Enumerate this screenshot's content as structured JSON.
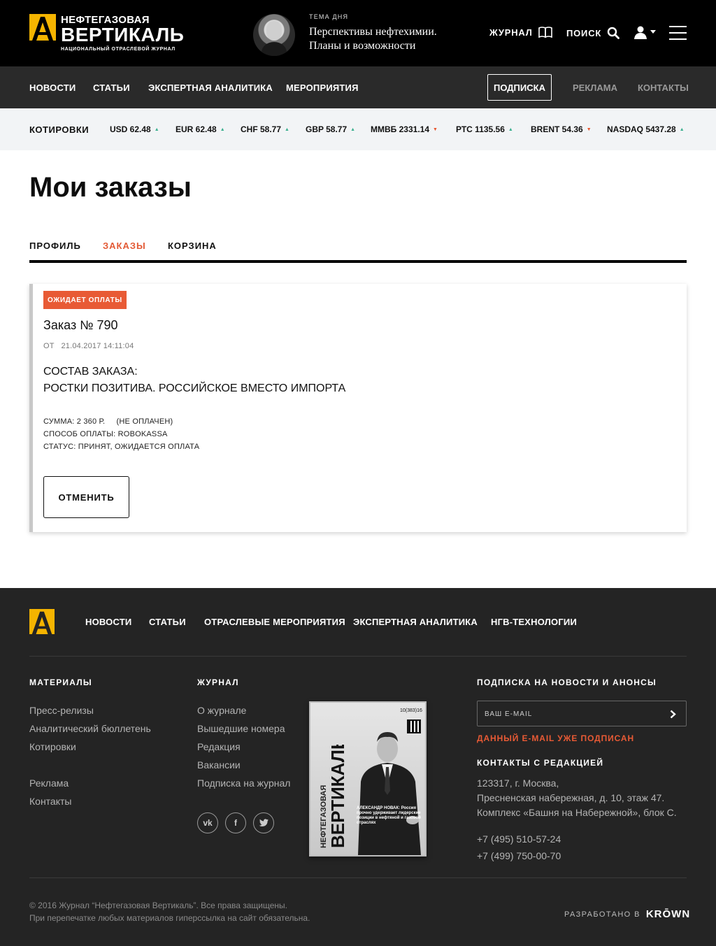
{
  "header": {
    "logo": {
      "line1": "НЕФТЕГАЗОВАЯ",
      "line2": "ВЕРТИКАЛЬ",
      "line3": "НАЦИОНАЛЬНЫЙ ОТРАСЛЕВОЙ ЖУРНАЛ"
    },
    "topic_label": "ТЕМА ДНЯ",
    "topic_line1": "Перспективы нефтехимии.",
    "topic_line2": "Планы и возможности",
    "journal_label": "ЖУРНАЛ",
    "search_label": "ПОИСК",
    "icons": [
      "book-icon",
      "search-icon",
      "user-icon",
      "caret-down-icon",
      "menu-icon"
    ]
  },
  "nav": {
    "items": [
      "НОВОСТИ",
      "СТАТЬИ",
      "ЭКСПЕРТНАЯ АНАЛИТИКА",
      "МЕРОПРИЯТИЯ"
    ],
    "subscribe": "ПОДПИСКА",
    "ads": "РЕКЛАМА",
    "contacts": "КОНТАКТЫ"
  },
  "quotes": {
    "label": "КОТИРОВКИ",
    "items": [
      {
        "text": "USD 62.48",
        "dir": "up"
      },
      {
        "text": "EUR 62.48",
        "dir": "up"
      },
      {
        "text": "CHF 58.77",
        "dir": "up"
      },
      {
        "text": "GBP 58.77",
        "dir": "up"
      },
      {
        "text": "ММВБ 2331.14",
        "dir": "down"
      },
      {
        "text": "РТС 1135.56",
        "dir": "up"
      },
      {
        "text": "BRENT 54.36",
        "dir": "down"
      },
      {
        "text": "NASDAQ 5437.28",
        "dir": "up"
      }
    ],
    "up_color": "#3bb08f",
    "down_color": "#e8552e"
  },
  "page": {
    "title": "Мои заказы",
    "tabs": [
      {
        "label": "ПРОФИЛЬ",
        "active": false
      },
      {
        "label": "ЗАКАЗЫ",
        "active": true
      },
      {
        "label": "КОРЗИНА",
        "active": false
      }
    ],
    "accent": "#e35a35"
  },
  "order": {
    "badge": "ОЖИДАЕТ ОПЛАТЫ",
    "title": "Заказ № 790",
    "date_prefix": "ОТ",
    "date": "21.04.2017 14:11:04",
    "composition_label": "СОСТАВ ЗАКАЗА:",
    "composition_item": "РОСТКИ ПОЗИТИВА. РОССИЙСКОЕ ВМЕСТО ИМПОРТА",
    "sum": "СУММА: 2 360 Р.",
    "paid_state": "(НЕ ОПЛАЧЕН)",
    "payment": "СПОСОБ ОПЛАТЫ: ROBOKASSA",
    "status": "СТАТУС: ПРИНЯТ, ОЖИДАЕТСЯ ОПЛАТА",
    "cancel_label": "ОТМЕНИТЬ"
  },
  "footer": {
    "nav": [
      "НОВОСТИ",
      "СТАТЬИ",
      "ОТРАСЛЕВЫЕ МЕРОПРИЯТИЯ",
      "ЭКСПЕРТНАЯ АНАЛИТИКА",
      "НГВ-ТЕХНОЛОГИИ"
    ],
    "materials_head": "МАТЕРИАЛЫ",
    "materials": [
      "Пресс-релизы",
      "Аналитический бюллетень",
      "Котировки"
    ],
    "materials2": [
      "Реклама",
      "Контакты"
    ],
    "journal_head": "ЖУРНАЛ",
    "journal": [
      "О журнале",
      "Вышедшие номера",
      "Редакция",
      "Вакансии",
      "Подписка на журнал"
    ],
    "social_icons": [
      "vk-icon",
      "facebook-icon",
      "twitter-icon"
    ],
    "cover": {
      "brand_small": "НЕФТЕГАЗОВАЯ",
      "brand_big": "ВЕРТИКАЛЬ",
      "issue": "10(383)16",
      "headline": "АЛЕКСАНДР НОВАК: Россия прочно удерживает лидерские позиции в нефтяной и газовой отраслях"
    },
    "subscribe_head": "ПОДПИСКА НА НОВОСТИ И АНОНСЫ",
    "email_placeholder": "ВАШ E-MAIL",
    "email_warning": "ДАННЫЙ E-MAIL УЖЕ ПОДПИСАН",
    "contacts_head": "КОНТАКТЫ С РЕДАКЦИЕЙ",
    "address": [
      "123317, г. Москва,",
      "Пресненская набережная, д. 10, этаж 47.",
      "Комплекс «Башня на Набережной», блок С."
    ],
    "phones": [
      "+7 (495) 510-57-24",
      "+7 (499) 750-00-70"
    ],
    "copyright1": "© 2016 Журнал “Нефтегазовая Вертикаль”. Все права защищены.",
    "copyright2": "При перепечатке любых материалов гиперссылка на сайт обязательна.",
    "dev_label": "РАЗРАБОТАНО В",
    "dev_brand": "KRŌWN"
  }
}
